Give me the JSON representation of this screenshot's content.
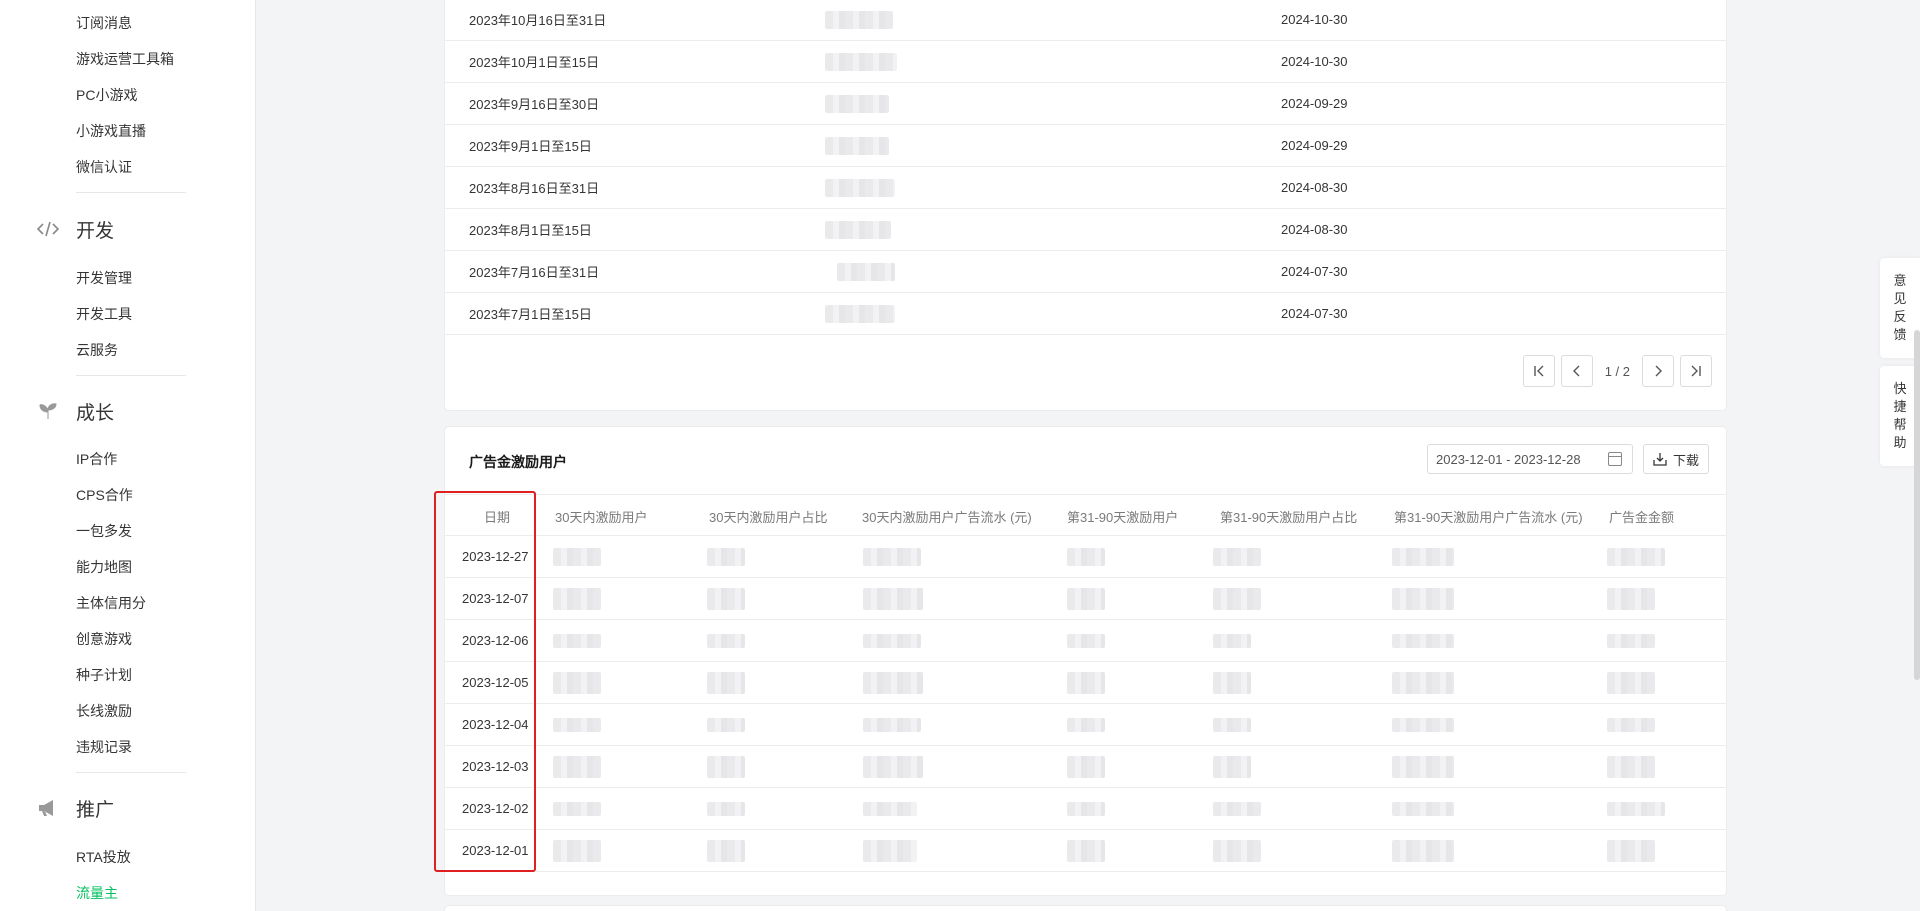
{
  "sidebar": {
    "items_top": [
      "订阅消息",
      "游戏运营工具箱",
      "PC小游戏",
      "小游戏直播",
      "微信认证"
    ],
    "group_dev": {
      "label": "开发",
      "icon": "code-icon"
    },
    "items_dev": [
      "开发管理",
      "开发工具",
      "云服务"
    ],
    "group_growth": {
      "label": "成长",
      "icon": "sprout-icon"
    },
    "items_growth": [
      "IP合作",
      "CPS合作",
      "一包多发",
      "能力地图",
      "主体信用分",
      "创意游戏",
      "种子计划",
      "长线激励",
      "违规记录"
    ],
    "group_promo": {
      "label": "推广",
      "icon": "megaphone-icon"
    },
    "items_promo": [
      "RTA投放",
      "流量主"
    ]
  },
  "settlement_table": {
    "rows": [
      {
        "period": "2023年10月16日至31日",
        "date": "2024-10-30"
      },
      {
        "period": "2023年10月1日至15日",
        "date": "2024-10-30"
      },
      {
        "period": "2023年9月16日至30日",
        "date": "2024-09-29"
      },
      {
        "period": "2023年9月1日至15日",
        "date": "2024-09-29"
      },
      {
        "period": "2023年8月16日至31日",
        "date": "2024-08-30"
      },
      {
        "period": "2023年8月1日至15日",
        "date": "2024-08-30"
      },
      {
        "period": "2023年7月16日至31日",
        "date": "2024-07-30"
      },
      {
        "period": "2023年7月1日至15日",
        "date": "2024-07-30"
      }
    ],
    "pager": {
      "text": "1 / 2"
    }
  },
  "incentive": {
    "title": "广告金激励用户",
    "date_range": "2023-12-01 - 2023-12-28",
    "download_label": "下载",
    "headers": [
      "日期",
      "30天内激励用户",
      "30天内激励用户占比",
      "30天内激励用户广告流水 (元)",
      "第31-90天激励用户",
      "第31-90天激励用户占比",
      "第31-90天激励用户广告流水 (元)",
      "广告金金额"
    ],
    "dates": [
      "2023-12-27",
      "2023-12-07",
      "2023-12-06",
      "2023-12-05",
      "2023-12-04",
      "2023-12-03",
      "2023-12-02",
      "2023-12-01"
    ]
  },
  "float": {
    "feedback": [
      "意",
      "见",
      "反",
      "馈"
    ],
    "help": [
      "快",
      "捷",
      "帮",
      "助"
    ]
  },
  "colors": {
    "accent": "#07c160",
    "highlight": "#e02020"
  }
}
